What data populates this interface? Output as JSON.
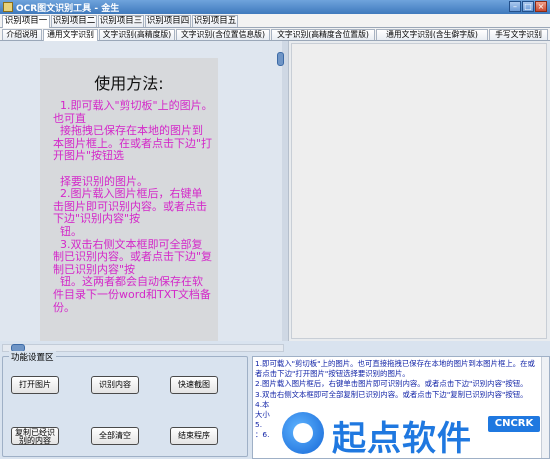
{
  "window": {
    "title": "OCR图文识别工具 - 金生"
  },
  "project_tabs": [
    {
      "label": "识别项目一",
      "active": true
    },
    {
      "label": "识别项目二",
      "active": false
    },
    {
      "label": "识别项目三",
      "active": false
    },
    {
      "label": "识别项目四",
      "active": false
    },
    {
      "label": "识别项目五",
      "active": false
    }
  ],
  "mode_tabs": [
    {
      "label": "介绍说明",
      "active": false
    },
    {
      "label": "通用文字识别",
      "active": true
    },
    {
      "label": "文字识别(高精度版)",
      "active": false
    },
    {
      "label": "文字识别(含位置信息版)",
      "active": false
    },
    {
      "label": "文字识别(高精度含位置版)",
      "active": false
    },
    {
      "label": "通用文字识别(含生僻字版)",
      "active": false
    },
    {
      "label": "手写文字识别",
      "active": false
    }
  ],
  "instructions": {
    "title": "使用方法:",
    "body": "  1.即可载入\"剪切板\"上的图片。也可直\n  接拖拽已保存在本地的图片到本图片框上。在或者点击下边\"打开图片\"按钮选\n\n  择要识别的图片。\n  2.图片载入图片框后，右键单击图片即可识别内容。或者点击下边\"识别内容\"按\n  钮。\n  3.双击右侧文本框即可全部复制已识别内容。或者点击下边\"复制已识别内容\"按\n  钮。这两者都会自动保存在软件目录下一份word和TXT文档备份。"
  },
  "function_group": {
    "label": "功能设置区",
    "buttons": {
      "open_image": "打开图片",
      "recognize": "识别内容",
      "screenshot": "快速截图",
      "copy_recognized": "复制已经识别的内容",
      "clear_all": "全部清空",
      "exit": "结束程序"
    }
  },
  "log": {
    "text": "1.即可载入\"剪切板\"上的图片。也可直接拖拽已保存在本地的图片到本图片框上。在或者点击下边\"打开图片\"按钮选择要识别的图片。\n2.图片载入图片框后，右键单击图片即可识别内容。或者点击下边\"识别内容\"按钮。\n3.双击右侧文本框即可全部复制已识别内容。或者点击下边\"复制已识别内容\"按钮。\n4.本\n大小\n5.\n：6."
  },
  "watermark": {
    "text": "起点软件",
    "badge": "CNCRK"
  },
  "colors": {
    "instruction_text": "#d428c9",
    "log_text": "#1426a8",
    "watermark_blue": "#1f78e0"
  }
}
